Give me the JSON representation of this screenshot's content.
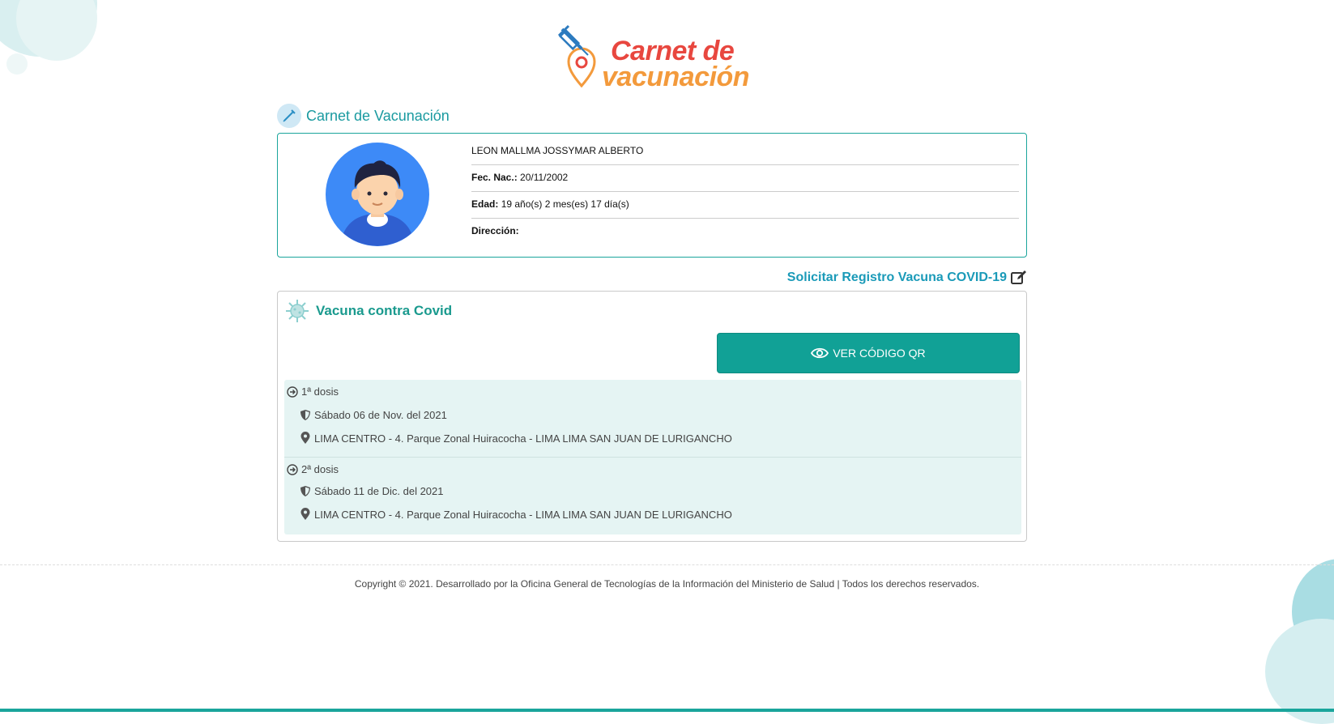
{
  "logo": {
    "line1": "Carnet de",
    "line2": "vacunación"
  },
  "section": {
    "title": "Carnet de Vacunación"
  },
  "person": {
    "name": "LEON MALLMA JOSSYMAR ALBERTO",
    "birth_label": "Fec. Nac.:",
    "birth_value": "20/11/2002",
    "age_label": "Edad:",
    "age_value": "19 año(s) 2 mes(es) 17 día(s)",
    "address_label": "Dirección:",
    "address_value": ""
  },
  "request_link": {
    "label": "Solicitar Registro Vacuna COVID-19",
    "icon": "edit-icon"
  },
  "vaccine": {
    "title": "Vacuna contra Covid",
    "qr_button": "VER CÓDIGO QR",
    "doses": [
      {
        "label": "1ª dosis",
        "date": "Sábado 06 de Nov. del 2021",
        "place": "LIMA CENTRO - 4. Parque Zonal Huiracocha - LIMA LIMA SAN JUAN DE LURIGANCHO"
      },
      {
        "label": "2ª dosis",
        "date": "Sábado 11 de Dic. del 2021",
        "place": "LIMA CENTRO - 4. Parque Zonal Huiracocha - LIMA LIMA SAN JUAN DE LURIGANCHO"
      }
    ]
  },
  "footer": {
    "text": "Copyright © 2021. Desarrollado por la Oficina General de Tecnologías de la Información del Ministerio de Salud | Todos los derechos reservados."
  },
  "colors": {
    "accent": "#1aa59c",
    "link": "#1a9ab8",
    "logo_red": "#e8473f",
    "logo_orange": "#f39a3c"
  }
}
